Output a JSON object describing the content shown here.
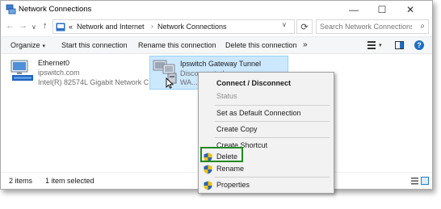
{
  "window": {
    "title": "Network Connections",
    "controls": {
      "minimize": "—",
      "maximize": "☐",
      "close": "✕"
    }
  },
  "address": {
    "overflow": "«",
    "breadcrumbs": [
      "Network and Internet",
      "Network Connections"
    ],
    "separator": "›",
    "search_placeholder": "Search Network Connections"
  },
  "toolbar": {
    "organize": "Organize",
    "start": "Start this connection",
    "rename": "Rename this connection",
    "delete": "Delete this connection",
    "more": "»"
  },
  "items": [
    {
      "name": "Ethernet0",
      "status": "ipswitch.com",
      "device": "Intel(R) 82574L Gigabit Network C..."
    },
    {
      "name": "Ipswitch Gateway Tunnel",
      "status": "Disconnected",
      "device": "WA..."
    }
  ],
  "context_menu": {
    "items": [
      {
        "label": "Connect / Disconnect",
        "bold": true
      },
      {
        "label": "Status",
        "disabled": true
      },
      {
        "label": "Set as Default Connection"
      },
      {
        "label": "Create Copy"
      },
      {
        "label": "Create Shortcut"
      },
      {
        "label": "Delete",
        "icon": "shield-icon"
      },
      {
        "label": "Rename",
        "icon": "shield-icon"
      },
      {
        "label": "Properties",
        "icon": "shield-icon"
      }
    ]
  },
  "statusbar": {
    "count": "2 items",
    "selected": "1 item selected"
  },
  "colors": {
    "accent": "#1e6fc4",
    "selection": "#cce8ff",
    "highlight": "#1f8b1f"
  }
}
